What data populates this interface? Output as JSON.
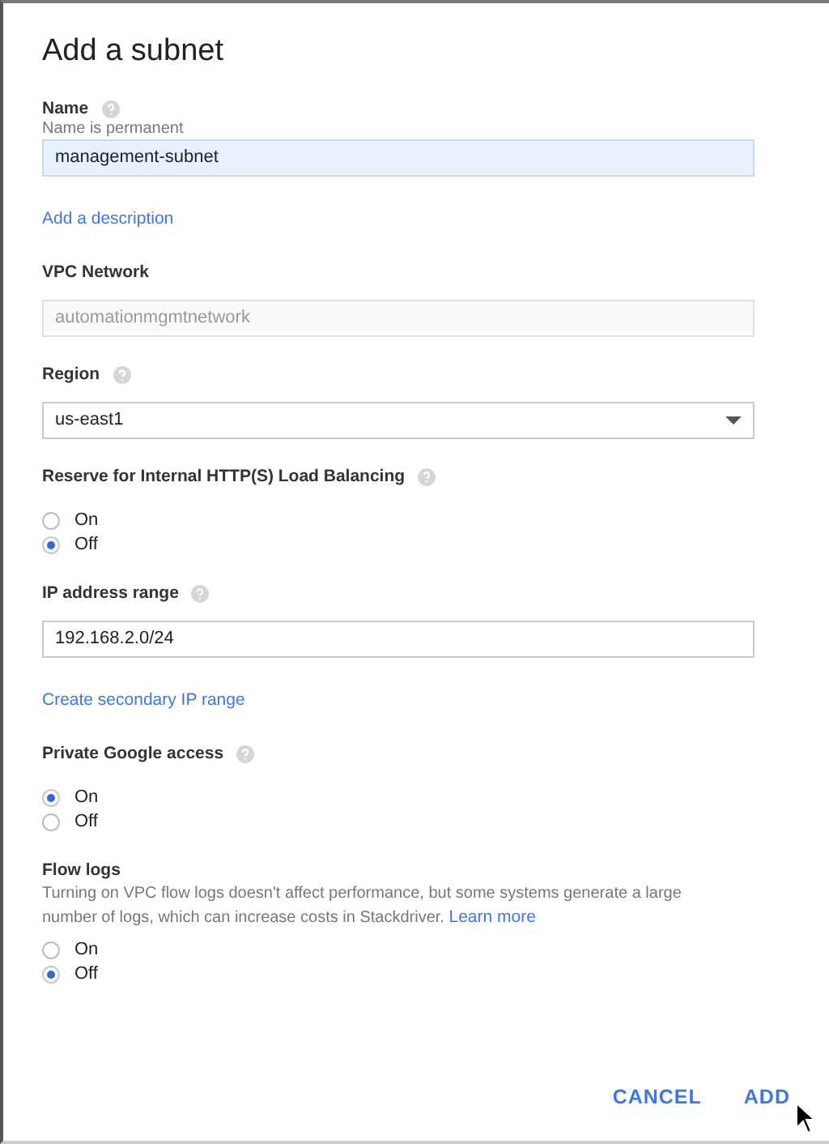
{
  "dialog": {
    "title": "Add a subnet"
  },
  "sections": [
    {
      "kind": "text_field",
      "label": "Name",
      "help": true,
      "hint": "Name is permanent",
      "value": "management-subnet",
      "autofilled": true,
      "disabled": false
    },
    {
      "kind": "link",
      "text": "Add a description"
    },
    {
      "kind": "text_field",
      "label": "VPC Network",
      "help": false,
      "value": "automationmgmtnetwork",
      "autofilled": false,
      "disabled": true
    },
    {
      "kind": "select",
      "label": "Region",
      "help": true,
      "value": "us-east1"
    },
    {
      "kind": "radio_group",
      "label": "Reserve for Internal HTTP(S) Load Balancing",
      "help": true,
      "options": [
        {
          "label": "On",
          "selected": false
        },
        {
          "label": "Off",
          "selected": true
        }
      ]
    },
    {
      "kind": "text_field",
      "label": "IP address range",
      "help": true,
      "value": "192.168.2.0/24",
      "autofilled": false,
      "disabled": false
    },
    {
      "kind": "link",
      "text": "Create secondary IP range"
    },
    {
      "kind": "radio_group",
      "label": "Private Google access",
      "help": true,
      "options": [
        {
          "label": "On",
          "selected": true
        },
        {
          "label": "Off",
          "selected": false
        }
      ]
    },
    {
      "kind": "radio_group",
      "label": "Flow logs",
      "help": false,
      "description": "Turning on VPC flow logs doesn't affect performance, but some systems generate a large number of logs, which can increase costs in Stackdriver.",
      "description_link": "Learn more",
      "options": [
        {
          "label": "On",
          "selected": false
        },
        {
          "label": "Off",
          "selected": true
        }
      ]
    }
  ],
  "buttons": [
    "CANCEL",
    "ADD"
  ]
}
